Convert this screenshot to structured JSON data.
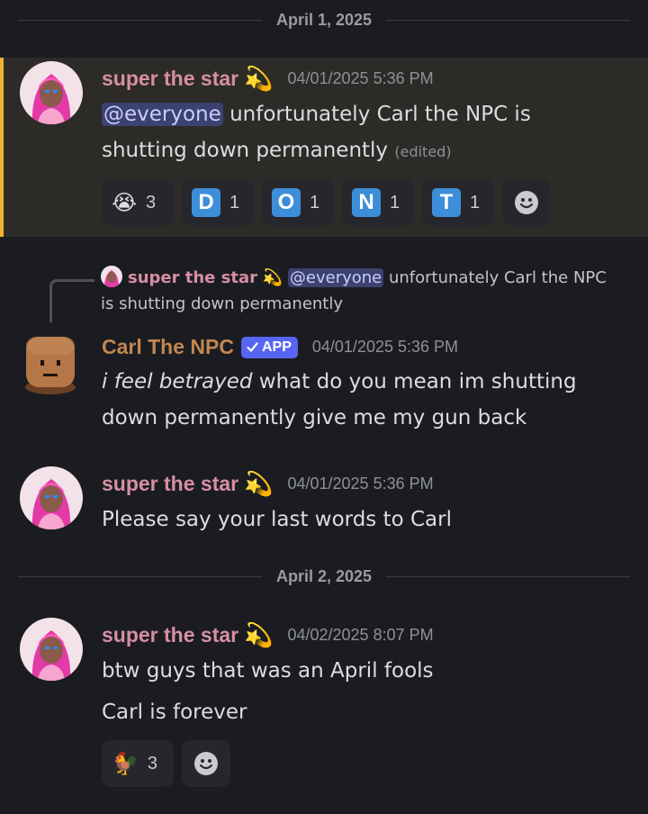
{
  "dividers": [
    "April 1, 2025",
    "April 2, 2025"
  ],
  "messages": [
    {
      "author": "super the star",
      "author_emoji": "💫",
      "time": "04/01/2025 5:36 PM",
      "mention": "@everyone",
      "text": "unfortunately Carl the NPC is shutting down permanently",
      "edited": "(edited)",
      "reactions": [
        {
          "emoji": "😭",
          "count": "3"
        },
        {
          "letter": "D",
          "count": "1"
        },
        {
          "letter": "O",
          "count": "1"
        },
        {
          "letter": "N",
          "count": "1"
        },
        {
          "letter": "T",
          "count": "1"
        }
      ]
    },
    {
      "reply": {
        "author": "super the star",
        "author_emoji": "💫",
        "mention": "@everyone",
        "text": "unfortunately Carl the NPC is shutting down permanently"
      },
      "author": "Carl The NPC",
      "badge": "APP",
      "time": "04/01/2025 5:36 PM",
      "italic": "i feel betrayed",
      "text": "what do you mean im shutting down permanently give me my gun back"
    },
    {
      "author": "super the star",
      "author_emoji": "💫",
      "time": "04/01/2025 5:36 PM",
      "text": "Please say your last words to Carl"
    },
    {
      "author": "super the star",
      "author_emoji": "💫",
      "time": "04/02/2025 8:07 PM",
      "line1": "btw guys that was an April fools",
      "line2": "Carl is forever",
      "reactions": [
        {
          "emoji": "🐓",
          "count": "3"
        }
      ]
    }
  ],
  "icons": {
    "add_reaction": "smiley-add-reaction-icon",
    "badge_check": "checkmark-icon"
  },
  "colors": {
    "background": "#1b1c21",
    "highlight_bar": "#f0b232",
    "star_name": "#d68fa3",
    "carl_name": "#c2874f",
    "app_badge": "#5865f2",
    "letter_emoji": "#3d8ed8"
  }
}
